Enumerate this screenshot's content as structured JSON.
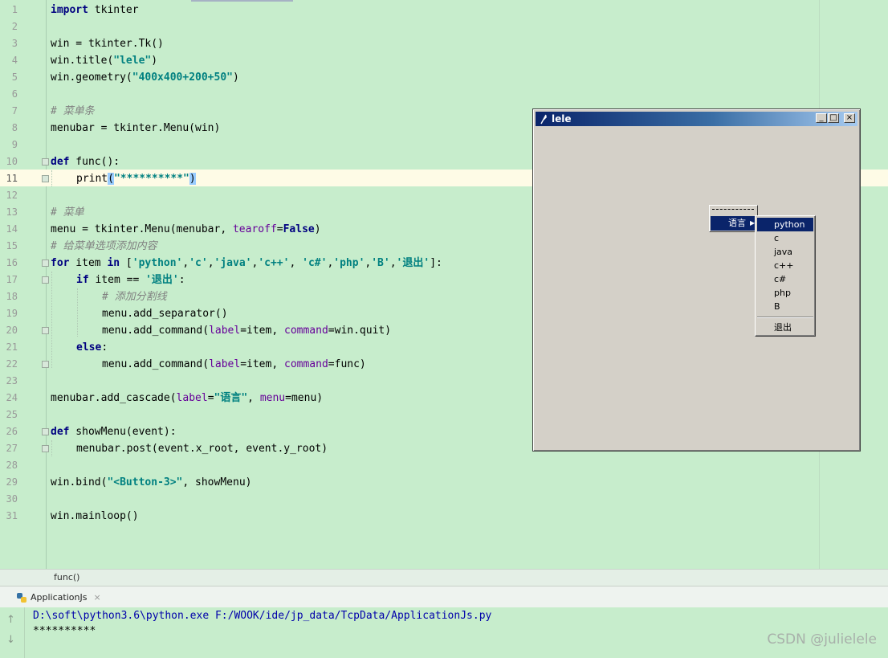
{
  "editor": {
    "lines": [
      {
        "n": "1"
      },
      {
        "n": "2"
      },
      {
        "n": "3"
      },
      {
        "n": "4"
      },
      {
        "n": "5"
      },
      {
        "n": "6"
      },
      {
        "n": "7"
      },
      {
        "n": "8"
      },
      {
        "n": "9"
      },
      {
        "n": "10"
      },
      {
        "n": "11"
      },
      {
        "n": "12"
      },
      {
        "n": "13"
      },
      {
        "n": "14"
      },
      {
        "n": "15"
      },
      {
        "n": "16"
      },
      {
        "n": "17"
      },
      {
        "n": "18"
      },
      {
        "n": "19"
      },
      {
        "n": "20"
      },
      {
        "n": "21"
      },
      {
        "n": "22"
      },
      {
        "n": "23"
      },
      {
        "n": "24"
      },
      {
        "n": "25"
      },
      {
        "n": "26"
      },
      {
        "n": "27"
      },
      {
        "n": "28"
      },
      {
        "n": "29"
      },
      {
        "n": "30"
      },
      {
        "n": "31"
      }
    ],
    "code": {
      "l1_kw": "import",
      "l1_rest": " tkinter",
      "l3": "win = tkinter.Tk()",
      "l4_a": "win.title(",
      "l4_s": "\"lele\"",
      "l4_b": ")",
      "l5_a": "win.geometry(",
      "l5_s": "\"400x400+200+50\"",
      "l5_b": ")",
      "l7": "# 菜单条",
      "l8": "menubar = tkinter.Menu(win)",
      "l10_kw": "def",
      "l10_rest": " func():",
      "l11_a": "print",
      "l11_b": "(",
      "l11_s": "\"**********\"",
      "l11_c": ")",
      "l13": "# 菜单",
      "l14_a": "menu = tkinter.Menu(menubar, ",
      "l14_p": "tearoff",
      "l14_b": "=",
      "l14_kw": "False",
      "l14_c": ")",
      "l15": "# 给菜单选项添加内容",
      "l16_kw1": "for",
      "l16_a": " item ",
      "l16_kw2": "in",
      "l16_b": " [",
      "l16_s1": "'python'",
      "l16_s2": "'c'",
      "l16_s3": "'java'",
      "l16_s4": "'c++'",
      "l16_s5": "'c#'",
      "l16_s6": "'php'",
      "l16_s7": "'B'",
      "l16_s8": "'退出'",
      "l16_c": "]:",
      "l17_kw": "if",
      "l17_a": " item == ",
      "l17_s": "'退出'",
      "l17_b": ":",
      "l18": "# 添加分割线",
      "l19": "menu.add_separator()",
      "l20_a": "menu.add_command(",
      "l20_p1": "label",
      "l20_b": "=item, ",
      "l20_p2": "command",
      "l20_c": "=win.quit)",
      "l21_kw": "else",
      "l21_a": ":",
      "l22_a": "menu.add_command(",
      "l22_p1": "label",
      "l22_b": "=item, ",
      "l22_p2": "command",
      "l22_c": "=func)",
      "l24_a": "menubar.add_cascade(",
      "l24_p1": "label",
      "l24_b": "=",
      "l24_s": "\"语言\"",
      "l24_c": ", ",
      "l24_p2": "menu",
      "l24_d": "=menu)",
      "l26_kw": "def",
      "l26_rest": " showMenu(event):",
      "l27": "menubar.post(event.x_root, event.y_root)",
      "l29_a": "win.bind(",
      "l29_s": "\"<Button-3>\"",
      "l29_b": ", showMenu)",
      "l31": "win.mainloop()"
    }
  },
  "breadcrumb": "func()",
  "run_panel": {
    "tab_label": "ApplicationJs",
    "tab_close": "×",
    "console_cmd": "D:\\soft\\python3.6\\python.exe F:/WOOK/ide/jp_data/TcpData/ApplicationJs.py",
    "console_output": "**********",
    "watermark": "CSDN @julielele"
  },
  "tk_window": {
    "title": "lele",
    "btn_min": "_",
    "btn_max": "□",
    "btn_close": "×",
    "popup_label": "语言",
    "popup_arrow": "▶",
    "submenu": [
      "python",
      "c",
      "java",
      "c++",
      "c#",
      "php",
      "B"
    ],
    "submenu_quit": "退出"
  },
  "colors": {
    "editor_bg": "#c7edcc",
    "keyword": "#000080",
    "string": "#008080",
    "comment": "#808080",
    "param": "#660099",
    "win_title_start": "#0a246a",
    "win_face": "#d4d0c8"
  }
}
